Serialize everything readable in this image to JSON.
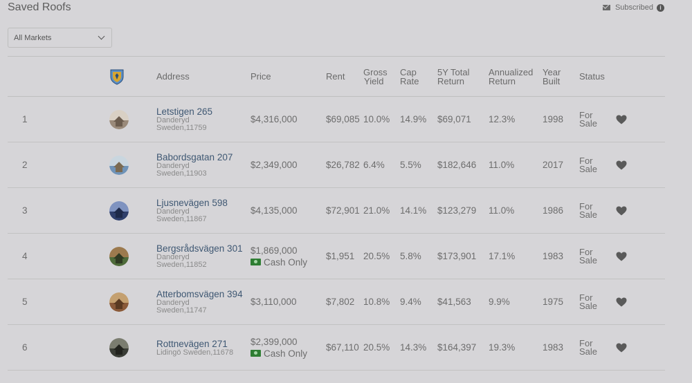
{
  "header": {
    "title": "Saved Roofs",
    "subscribed_label": "Subscribed"
  },
  "filter": {
    "market_selected": "All Markets"
  },
  "table": {
    "columns": {
      "address": "Address",
      "price": "Price",
      "rent": "Rent",
      "gross_yield_1": "Gross",
      "gross_yield_2": "Yield",
      "cap_rate_1": "Cap",
      "cap_rate_2": "Rate",
      "total_return_1": "5Y Total",
      "total_return_2": "Return",
      "annualized_1": "Annualized",
      "annualized_2": "Return",
      "year_built_1": "Year",
      "year_built_2": "Built",
      "status": "Status"
    },
    "rows": [
      {
        "num": "1",
        "street": "Letstigen 265",
        "line1": "Danderyd",
        "line2": "Sweden,11759",
        "price": "$4,316,000",
        "cash": "",
        "rent": "$69,085",
        "gross": "10.0%",
        "cap": "14.9%",
        "total5y": "$69,071",
        "annualized": "12.3%",
        "year": "1998",
        "status1": "For",
        "status2": "Sale"
      },
      {
        "num": "2",
        "street": "Babordsgatan 207",
        "line1": "Danderyd",
        "line2": "Sweden,11903",
        "price": "$2,349,000",
        "cash": "",
        "rent": "$26,782",
        "gross": "6.4%",
        "cap": "5.5%",
        "total5y": "$182,646",
        "annualized": "11.0%",
        "year": "2017",
        "status1": "For",
        "status2": "Sale"
      },
      {
        "num": "3",
        "street": "Ljusnevägen 598",
        "line1": "Danderyd",
        "line2": "Sweden,11867",
        "price": "$4,135,000",
        "cash": "",
        "rent": "$72,901",
        "gross": "21.0%",
        "cap": "14.1%",
        "total5y": "$123,279",
        "annualized": "11.0%",
        "year": "1986",
        "status1": "For",
        "status2": "Sale"
      },
      {
        "num": "4",
        "street": "Bergsrådsvägen 301",
        "line1": "Danderyd",
        "line2": "Sweden,11852",
        "price": "$1,869,000",
        "cash": "Cash Only",
        "rent": "$1,951",
        "gross": "20.5%",
        "cap": "5.8%",
        "total5y": "$173,901",
        "annualized": "17.1%",
        "year": "1983",
        "status1": "For",
        "status2": "Sale"
      },
      {
        "num": "5",
        "street": "Atterbomsvägen 394",
        "line1": "Danderyd",
        "line2": "Sweden,11747",
        "price": "$3,110,000",
        "cash": "",
        "rent": "$7,802",
        "gross": "10.8%",
        "cap": "9.4%",
        "total5y": "$41,563",
        "annualized": "9.9%",
        "year": "1975",
        "status1": "For",
        "status2": "Sale"
      },
      {
        "num": "6",
        "street": "Rottnevägen 271",
        "line1": "Lidingö Sweden,11678",
        "line2": "",
        "price": "$2,399,000",
        "cash": "Cash Only",
        "rent": "$67,110",
        "gross": "20.5%",
        "cap": "14.3%",
        "total5y": "$164,397",
        "annualized": "19.3%",
        "year": "1983",
        "status1": "For",
        "status2": "Sale"
      }
    ]
  },
  "icons": {
    "mail": "mail-icon",
    "info": "info-icon",
    "emblem": "coat-of-arms-icon",
    "heart": "heart-icon",
    "cash": "cash-icon",
    "chevron": "chevron-down-icon"
  },
  "colors": {
    "background": "#d6d5d8",
    "link": "#3f5873",
    "cash_green": "#2e7d32"
  }
}
